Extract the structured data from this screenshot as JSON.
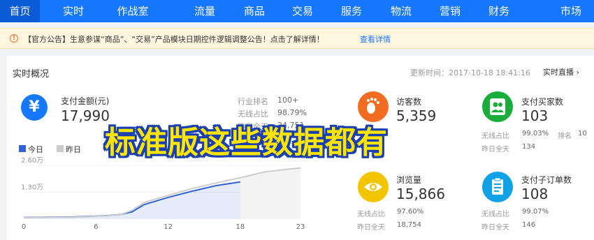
{
  "topnav": {
    "items": [
      {
        "label": "首页",
        "active": true
      },
      {
        "label": "实时"
      },
      {
        "label": "作战室"
      },
      {
        "label": "流量"
      },
      {
        "label": "商品"
      },
      {
        "label": "交易"
      },
      {
        "label": "服务"
      },
      {
        "label": "物流"
      },
      {
        "label": "营销"
      },
      {
        "label": "财务"
      },
      {
        "label": "市场"
      }
    ]
  },
  "notice": {
    "icon": "warning-circle-icon",
    "text": "【官方公告】生意参谋“商品”、“交易”产品模块日期控件逻辑调整公告！点击了解详情！",
    "link": "查看详情"
  },
  "realtime": {
    "title": "实时概况",
    "update_time": "更新时间：2017-10-18 18:41:16",
    "live_link": "实时直播 ›",
    "pay": {
      "icon": "yen-icon",
      "label": "支付金额(元)",
      "value": "17,990",
      "rank_label": "行业排名",
      "rank_value": "100+",
      "wireless_label": "无线占比",
      "wireless_value": "98.79%",
      "yesterday_label": "昨日全天",
      "yesterday_value": "24,751"
    }
  },
  "chart_data": {
    "type": "line",
    "series": [
      {
        "name": "今日",
        "color": "#2f63d6",
        "x": [
          0,
          4,
          7,
          8,
          9,
          10,
          12,
          14,
          16,
          18
        ],
        "values": [
          800,
          1000,
          1700,
          2200,
          3500,
          7000,
          10500,
          13500,
          16200,
          17990
        ]
      },
      {
        "name": "昨日",
        "color": "#cccccc",
        "x": [
          0,
          4,
          7,
          8,
          9,
          10,
          12,
          14,
          16,
          18,
          20,
          22,
          23
        ],
        "values": [
          700,
          900,
          1600,
          2100,
          4200,
          8000,
          11500,
          14800,
          17500,
          20000,
          22800,
          24200,
          24751
        ]
      }
    ],
    "x_ticks": [
      "0",
      "6",
      "12",
      "18",
      "23"
    ],
    "y_ticks": [
      "1.30万",
      "2.60万"
    ],
    "xlim": [
      0,
      23
    ],
    "ylim": [
      0,
      26000
    ]
  },
  "metrics": [
    {
      "icon": "footprint-icon",
      "color": "#f26d21",
      "label": "访客数",
      "value": "5,359",
      "sub1_label": "",
      "sub1_value": "",
      "sub2_label": "",
      "sub2_value": ""
    },
    {
      "icon": "user-group-icon",
      "color": "#1aad3c",
      "label": "支付买家数",
      "value": "103",
      "sub1_label": "无线占比",
      "sub1_value": "99.03%",
      "rank_label": "排名",
      "rank_value": "10",
      "sub2_label": "昨日全天",
      "sub2_value": "134"
    },
    {
      "icon": "eye-icon",
      "color": "#f3c500",
      "label": "浏览量",
      "value": "15,866",
      "sub1_label": "无线占比",
      "sub1_value": "97.60%",
      "sub2_label": "昨日全天",
      "sub2_value": "18,754"
    },
    {
      "icon": "order-icon",
      "color": "#13a1e6",
      "label": "支付子订单数",
      "value": "108",
      "sub1_label": "无线占比",
      "sub1_value": "99.07%",
      "sub2_label": "昨日全天",
      "sub2_value": "146"
    }
  ],
  "overlay": {
    "text": "标准版这些数据都有"
  }
}
